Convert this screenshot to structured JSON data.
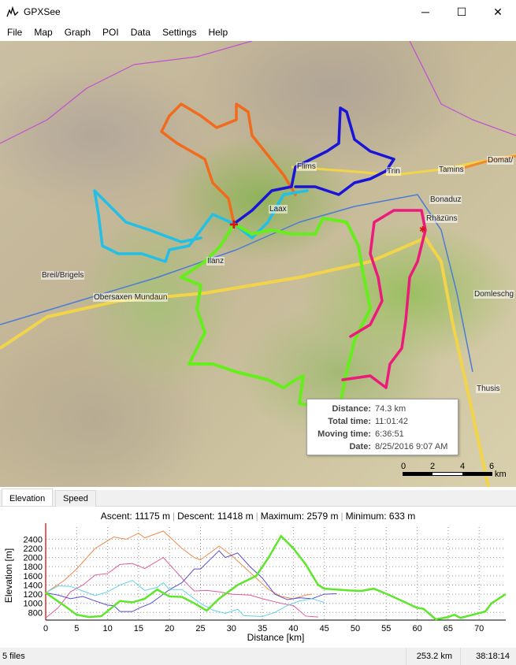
{
  "window": {
    "title": "GPXSee",
    "minimize": "─",
    "maximize": "☐",
    "close": "✕",
    "icon": "gpxsee-app-icon"
  },
  "menu": [
    "File",
    "Map",
    "Graph",
    "POI",
    "Data",
    "Settings",
    "Help"
  ],
  "map": {
    "places": [
      "Flims",
      "Trin",
      "Tamins",
      "Domat/",
      "Bonaduz",
      "Rhäzüns",
      "Laax",
      "Ilanz",
      "Breil/Brigels",
      "Obersaxen Mundaun",
      "Domleschg",
      "Thusis"
    ],
    "track_colors": {
      "orange": "#f26a1b",
      "blue": "#1a14d8",
      "cyan": "#22bfe6",
      "green": "#66ee1c",
      "pink": "#ec1a7a"
    },
    "tooltip": {
      "rows": [
        {
          "label": "Distance:",
          "value": "74.3 km"
        },
        {
          "label": "Total time:",
          "value": "11:01:42"
        },
        {
          "label": "Moving time:",
          "value": "6:36:51"
        },
        {
          "label": "Date:",
          "value": "8/25/2016 9:07 AM"
        }
      ]
    },
    "scale": {
      "ticks": [
        "0",
        "2",
        "4",
        "6"
      ],
      "unit": "km"
    }
  },
  "tabs": [
    {
      "label": "Elevation",
      "active": true
    },
    {
      "label": "Speed",
      "active": false
    }
  ],
  "graph": {
    "stats": [
      "Ascent: 11175 m",
      "Descent: 11418 m",
      "Maximum: 2579 m",
      "Minimum: 633 m"
    ]
  },
  "chart_data": {
    "type": "line",
    "xlabel": "Distance [km]",
    "ylabel": "Elevation [m]",
    "xlim": [
      0,
      74.3
    ],
    "ylim": [
      633,
      2579
    ],
    "xticks": [
      0,
      5,
      10,
      15,
      20,
      25,
      30,
      35,
      40,
      45,
      50,
      55,
      60,
      65,
      70
    ],
    "yticks": [
      800,
      1000,
      1200,
      1400,
      1600,
      1800,
      2000,
      2200,
      2400
    ],
    "grid": true,
    "series": [
      {
        "color": "#f08a4b",
        "points": [
          [
            0,
            1230
          ],
          [
            3,
            1500
          ],
          [
            5,
            1750
          ],
          [
            8,
            2200
          ],
          [
            11,
            2450
          ],
          [
            13,
            2400
          ],
          [
            15,
            2530
          ],
          [
            16,
            2430
          ],
          [
            19,
            2579
          ],
          [
            22,
            2200
          ],
          [
            24,
            2000
          ],
          [
            25,
            1950
          ],
          [
            28,
            2250
          ],
          [
            30,
            2050
          ],
          [
            32,
            1800
          ],
          [
            36,
            1300
          ],
          [
            38,
            1150
          ],
          [
            40,
            1100
          ],
          [
            42,
            1180
          ],
          [
            43,
            1200
          ]
        ]
      },
      {
        "color": "#e05a9a",
        "points": [
          [
            0,
            680
          ],
          [
            2,
            900
          ],
          [
            4,
            1250
          ],
          [
            6,
            1400
          ],
          [
            8,
            1620
          ],
          [
            10,
            1650
          ],
          [
            12,
            1850
          ],
          [
            14,
            1870
          ],
          [
            16,
            1760
          ],
          [
            19,
            2000
          ],
          [
            21,
            1700
          ],
          [
            23,
            1400
          ],
          [
            24,
            1270
          ],
          [
            26,
            1280
          ],
          [
            28,
            1250
          ],
          [
            30,
            1200
          ],
          [
            33,
            1180
          ],
          [
            35,
            1100
          ],
          [
            38,
            1000
          ],
          [
            40,
            950
          ],
          [
            42,
            720
          ],
          [
            44,
            700
          ]
        ]
      },
      {
        "color": "#5a4cd0",
        "points": [
          [
            0,
            1230
          ],
          [
            2,
            1180
          ],
          [
            4,
            1100
          ],
          [
            6,
            1150
          ],
          [
            8,
            1050
          ],
          [
            10,
            960
          ],
          [
            11,
            950
          ],
          [
            12,
            820
          ],
          [
            14,
            820
          ],
          [
            15,
            890
          ],
          [
            17,
            1000
          ],
          [
            20,
            1300
          ],
          [
            22,
            1450
          ],
          [
            24,
            1750
          ],
          [
            25,
            1750
          ],
          [
            28,
            2150
          ],
          [
            29,
            2000
          ],
          [
            31,
            2100
          ],
          [
            33,
            1800
          ],
          [
            35,
            1550
          ],
          [
            37,
            1200
          ],
          [
            39,
            1080
          ],
          [
            41,
            1120
          ],
          [
            43,
            1100
          ],
          [
            45,
            1200
          ],
          [
            47,
            1210
          ]
        ]
      },
      {
        "color": "#5fd4e8",
        "points": [
          [
            0,
            1230
          ],
          [
            2,
            1380
          ],
          [
            4,
            1370
          ],
          [
            6,
            1270
          ],
          [
            8,
            1170
          ],
          [
            10,
            1250
          ],
          [
            12,
            1400
          ],
          [
            14,
            1500
          ],
          [
            16,
            1280
          ],
          [
            18,
            1350
          ],
          [
            19,
            1450
          ],
          [
            20,
            1300
          ],
          [
            22,
            1300
          ],
          [
            25,
            1000
          ],
          [
            27,
            850
          ],
          [
            29,
            780
          ],
          [
            31,
            870
          ],
          [
            32,
            730
          ],
          [
            35,
            710
          ],
          [
            37,
            800
          ],
          [
            39,
            950
          ],
          [
            41,
            1050
          ],
          [
            43,
            1100
          ],
          [
            45,
            1020
          ]
        ]
      },
      {
        "color": "#5ee62a",
        "points": [
          [
            0,
            1230
          ],
          [
            3,
            950
          ],
          [
            5,
            750
          ],
          [
            7,
            700
          ],
          [
            9,
            720
          ],
          [
            12,
            1050
          ],
          [
            14,
            1020
          ],
          [
            16,
            1100
          ],
          [
            18,
            1300
          ],
          [
            20,
            1150
          ],
          [
            22,
            1140
          ],
          [
            24,
            1000
          ],
          [
            26,
            840
          ],
          [
            28,
            1100
          ],
          [
            31,
            1400
          ],
          [
            34,
            1600
          ],
          [
            36,
            2000
          ],
          [
            38,
            2470
          ],
          [
            40,
            2200
          ],
          [
            42,
            1850
          ],
          [
            44,
            1400
          ],
          [
            45,
            1320
          ],
          [
            49,
            1280
          ],
          [
            51,
            1270
          ],
          [
            53,
            1320
          ],
          [
            56,
            1150
          ],
          [
            60,
            900
          ],
          [
            61,
            880
          ],
          [
            63,
            650
          ],
          [
            65,
            700
          ],
          [
            66,
            750
          ],
          [
            67,
            680
          ],
          [
            69,
            750
          ],
          [
            71,
            820
          ],
          [
            72,
            1000
          ],
          [
            74.3,
            1200
          ]
        ]
      }
    ]
  },
  "status": {
    "files": "5 files",
    "distance": "253.2 km",
    "time": "38:18:14"
  }
}
